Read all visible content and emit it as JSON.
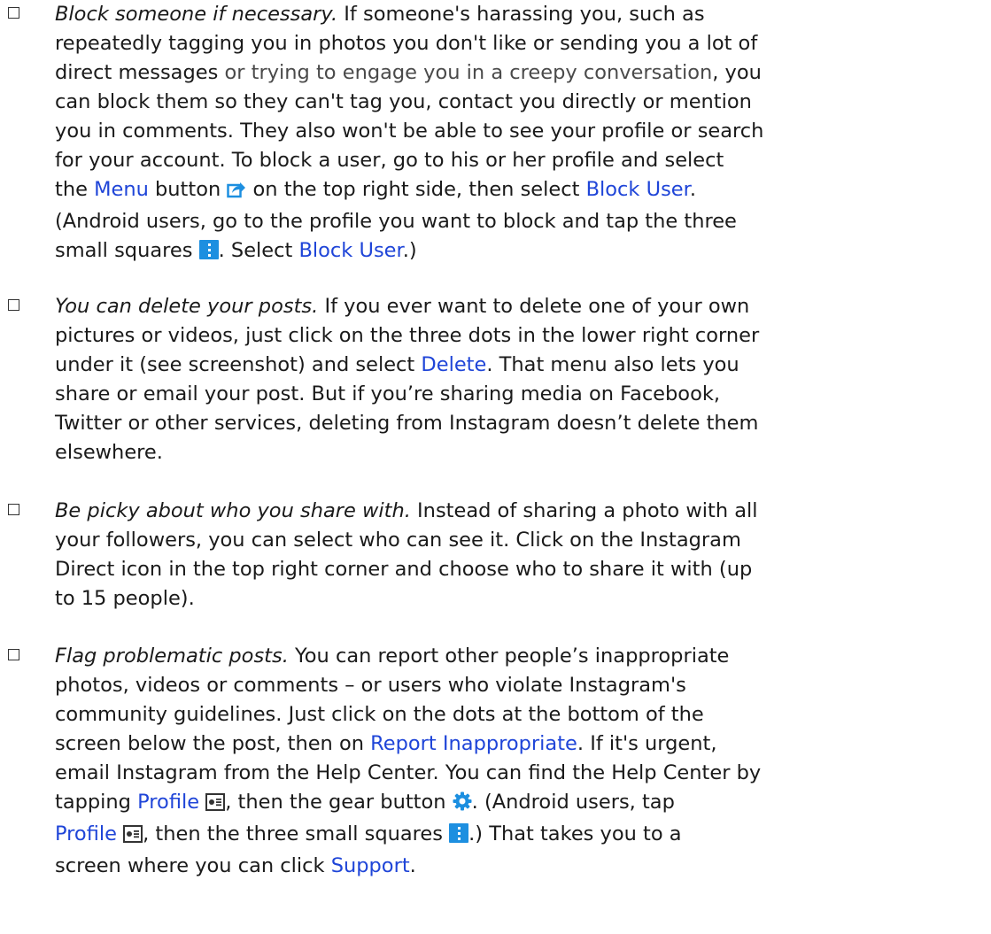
{
  "items": [
    {
      "title": "Block someone if necessary.",
      "l1": "If someone's harassing you, such as",
      "l2": "repeatedly tagging you in photos you don't like or sending you a lot of",
      "l3a": "direct messages",
      "l3b": " or trying to engage you in a creepy conversation",
      "l3c": ", you",
      "l4": "can block them so they can't tag you, contact you directly or mention",
      "l5": "you in comments. They also won't be able to see your profile or search",
      "l6": "for your account. To block a user, go to his or her profile and select",
      "l7a": "the ",
      "l7b": "Menu",
      "l7c": " button ",
      "l7d": " on the top right side, then select ",
      "l7e": "Block User",
      "l7f": ".",
      "l8": "(Android users, go to the profile you want to block and tap the three",
      "l9a": "small squares ",
      "l9b": ". Select ",
      "l9c": "Block User",
      "l9d": ".)"
    },
    {
      "title": "You can delete your posts.",
      "l1": "If you ever want to delete one of your own",
      "l2": "pictures or videos, just click on the three dots in the lower right corner",
      "l3a": "under it (see screenshot) and select ",
      "l3b": "Delete",
      "l3c": ". That menu also lets you",
      "l4": "share or email your post. But if you’re sharing media on Facebook,",
      "l5": "Twitter or other services, deleting from Instagram doesn’t delete them",
      "l6": "elsewhere."
    },
    {
      "title": "Be picky about who you share with.",
      "l1": "Instead of sharing a photo with all",
      "l2": "your followers, you can select who can see it. Click on the Instagram",
      "l3": "Direct icon in the top right corner and choose who to share it with (up",
      "l4": "to 15 people)."
    },
    {
      "title": "Flag problematic posts.",
      "l1": "You can report other people’s inappropriate",
      "l2": "photos, videos or comments – or users who violate Instagram's",
      "l3": "community guidelines. Just click on the dots at the bottom of the",
      "l4a": "screen below the post, then on ",
      "l4b": "Report Inappropriate",
      "l4c": ". If it's urgent,",
      "l5": "email Instagram from the Help Center. You can find the Help Center by",
      "l6a": "tapping ",
      "l6b": "Profile",
      "l6c": ", then the gear button ",
      "l6d": ". (Android users, tap",
      "l7a": "Profile",
      "l7b": ", then the three small squares ",
      "l7c": ".) That takes you to a",
      "l8a": "screen where you can click ",
      "l8b": "Support",
      "l8c": "."
    }
  ],
  "icons": {
    "share": "share-icon",
    "menu_squares": "three-squares-icon",
    "profile": "profile-icon",
    "gear": "gear-icon",
    "bullet": "checkbox-bullet-icon"
  },
  "colors": {
    "text": "#1a1a1a",
    "link": "#1f45d8",
    "icon_blue": "#1d8fe0"
  }
}
